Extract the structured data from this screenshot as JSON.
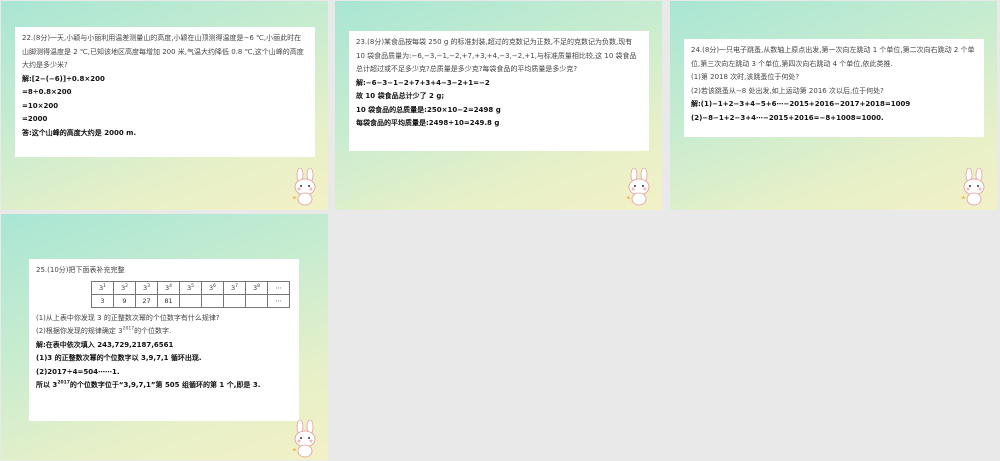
{
  "slide1": {
    "question": "22.(8分)一天,小颖与小丽利用温差测量山的高度,小颖在山顶测得温度是−6 ℃,小丽此时在山脚测得温度是 2 ℃,已知该地区高度每增加 200 米,气温大约降低 0.8 ℃,这个山峰的高度大约是多少米?",
    "answer_lines": [
      "解:[2−(−6)]÷0.8×200",
      "=8÷0.8×200",
      "=10×200",
      "=2000",
      "答:这个山峰的高度大约是 2000 m."
    ]
  },
  "slide2": {
    "question": "23.(8分)某食品按每袋 250 g 的标准封装,超过的克数记为正数,不足的克数记为负数,现有 10 袋食品质量为:−6,−3,−1,−2,+7,+3,+4,−3,−2,+1,与标准质量相比较,这 10 袋食品总计超过或不足多少克?总质量是多少克?每袋食品的平均质量是多少克?",
    "answer_lines": [
      "解:−6−3−1−2+7+3+4−3−2+1=−2",
      "故 10 袋食品总计少了 2 g;",
      "10 袋食品的总质量是:250×10−2=2498 g",
      "每袋食品的平均质量是:2498÷10=249.8 g"
    ]
  },
  "slide3": {
    "question_lines": [
      "24.(8分)一只电子跳蚤,从数轴上原点出发,第一次向左跳动 1 个单位,第二次向右跳动 2 个单位,第三次向左跳动 3 个单位,第四次向右跳动 4 个单位,依此类推.",
      "(1)第 2018 次时,该跳蚤位于何处?",
      "(2)若该跳蚤从−8 处出发,如上运动第 2016 次以后,位于何处?"
    ],
    "answer_lines": [
      "解:(1)−1+2−3+4−5+6⋯−2015+2016−2017+2018=1009",
      "(2)−8−1+2−3+4⋯−2015+2016=−8+1008=1000."
    ]
  },
  "slide4": {
    "title": "25.(10分)把下面表补充完整",
    "table_row1_base": "3",
    "table_row1_exps": [
      "1",
      "2",
      "3",
      "4",
      "5",
      "6",
      "7",
      "8"
    ],
    "table_row1_end": "⋯",
    "table_row2": [
      "3",
      "9",
      "27",
      "81",
      "",
      "",
      "",
      "",
      ""
    ],
    "table_row2_end": "⋯",
    "q1": "(1)从上表中你发现 3 的正整数次幂的个位数字有什么规律?",
    "q2_pre": "(2)根据你发现的规律确定 3",
    "q2_sup": "2017",
    "q2_post": "的个位数字.",
    "a1": "解:在表中依次填入 243,729,2187,6561",
    "a2": "(1)3 的正整数次幂的个位数字以 3,9,7,1 循环出现.",
    "a3": "(2)2017÷4=504⋯⋯1.",
    "a4_pre": "所以 3",
    "a4_sup": "2017",
    "a4_post": "的个位数字位于“3,9,7,1”第 505 组循环的第 1 个,即是 3."
  }
}
